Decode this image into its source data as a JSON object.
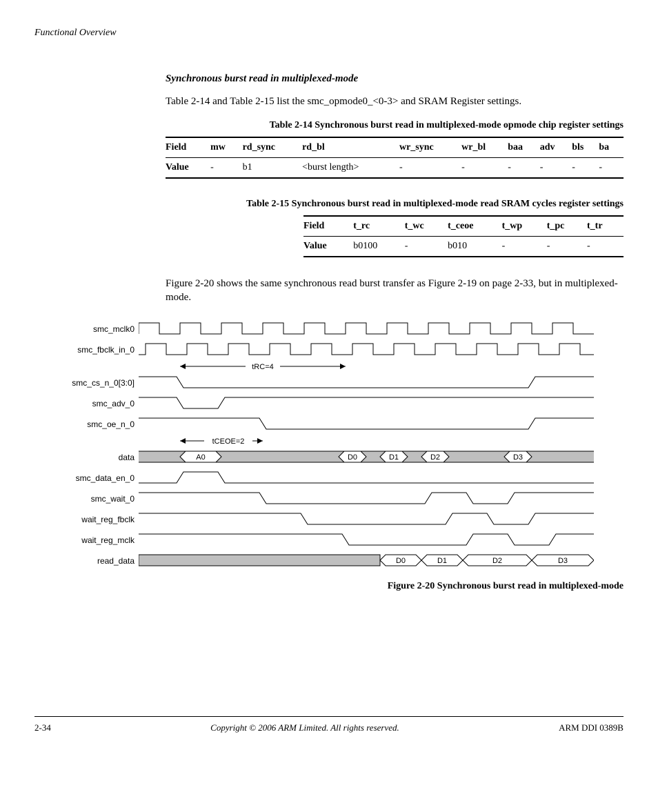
{
  "header": {
    "section": "Functional Overview"
  },
  "section": {
    "heading": "Synchronous burst read in multiplexed-mode",
    "intro": "Table 2-14 and Table 2-15 list the smc_opmode0_<0-3> and SRAM Register settings."
  },
  "table14": {
    "caption": "Table 2-14 Synchronous burst read in multiplexed-mode opmode chip register settings",
    "field_label": "Field",
    "value_label": "Value",
    "cols": [
      "mw",
      "rd_sync",
      "rd_bl",
      "wr_sync",
      "wr_bl",
      "baa",
      "adv",
      "bls",
      "ba"
    ],
    "values": [
      "-",
      "b1",
      "<burst length>",
      "-",
      "-",
      "-",
      "-",
      "-",
      "-"
    ]
  },
  "table15": {
    "caption": "Table 2-15 Synchronous burst read in multiplexed-mode read SRAM cycles register settings",
    "field_label": "Field",
    "value_label": "Value",
    "cols": [
      "t_rc",
      "t_wc",
      "t_ceoe",
      "t_wp",
      "t_pc",
      "t_tr"
    ],
    "values": [
      "b0100",
      "-",
      "b010",
      "-",
      "-",
      "-"
    ]
  },
  "figref": "Figure 2-20 shows the same synchronous read burst transfer as Figure 2-19 on page 2-33, but in multiplexed-mode.",
  "timing": {
    "signals": [
      "smc_mclk0",
      "smc_fbclk_in_0",
      "smc_cs_n_0[3:0]",
      "smc_adv_0",
      "smc_oe_n_0",
      "data",
      "smc_data_en_0",
      "smc_wait_0",
      "wait_reg_fbclk",
      "wait_reg_mclk",
      "read_data"
    ],
    "annot_trc": "tRC=4",
    "annot_tceoe": "tCEOE=2",
    "data_labels": [
      "A0",
      "D0",
      "D1",
      "D2",
      "D3"
    ],
    "read_data_labels": [
      "D0",
      "D1",
      "D2",
      "D3"
    ]
  },
  "figure_caption": "Figure 2-20 Synchronous burst read in multiplexed-mode",
  "footer": {
    "left": "2-34",
    "center": "Copyright © 2006 ARM Limited. All rights reserved.",
    "right": "ARM DDI 0389B"
  }
}
